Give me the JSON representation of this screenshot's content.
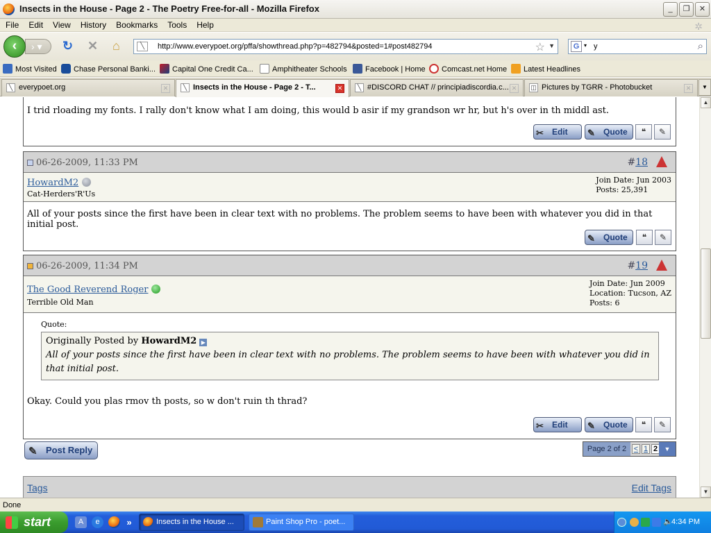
{
  "window": {
    "title": "Insects in the House - Page 2 - The Poetry Free-for-all - Mozilla Firefox",
    "minimize": "_",
    "maximize": "❐",
    "close": "✕"
  },
  "menu": [
    "File",
    "Edit",
    "View",
    "History",
    "Bookmarks",
    "Tools",
    "Help"
  ],
  "nav": {
    "url": "http://www.everypoet.org/pffa/showthread.php?p=482794&posted=1#post482794",
    "search_value": "y",
    "search_engine": "G"
  },
  "bookmarks": [
    "Most Visited",
    "Chase Personal Banki...",
    "Capital One Credit Ca...",
    "Amphitheater Schools",
    "Facebook | Home",
    "Comcast.net Home",
    "Latest Headlines"
  ],
  "tabs": [
    {
      "label": "everypoet.org",
      "active": false
    },
    {
      "label": "Insects in the House - Page 2 - T...",
      "active": true
    },
    {
      "label": "#DISCORD CHAT // principiadiscordia.c...",
      "active": false
    },
    {
      "label": "Pictures by TGRR - Photobucket",
      "active": false
    }
  ],
  "post17": {
    "body": "I trid rloading my fonts. I rally don't know what I am doing, this would b asir if my grandson wr hr, but h's over in th middl ast.",
    "edit_label": "Edit",
    "quote_label": "Quote"
  },
  "post18": {
    "date": "06-26-2009, 11:33 PM",
    "number_prefix": "#",
    "number": "18",
    "username": "HowardM2",
    "user_title": "Cat-Herders'R'Us",
    "join_date": "Join Date: Jun 2003",
    "posts": "Posts: 25,391",
    "body": "All of your posts since the first have been in clear text with no problems. The problem seems to have been with whatever you did in that initial post.",
    "quote_label": "Quote"
  },
  "post19": {
    "date": "06-26-2009, 11:34 PM",
    "number_prefix": "#",
    "number": "19",
    "username": "The Good Reverend Roger",
    "user_title": "Terrible Old Man",
    "join_date": "Join Date: Jun 2009",
    "location": "Location: Tucson, AZ",
    "posts": "Posts: 6",
    "quote_heading": "Quote:",
    "quote_by_prefix": "Originally Posted by",
    "quote_author": "HowardM2",
    "quote_text": "All of your posts since the first have been in clear text with no problems. The problem seems to have been with whatever you did in that initial post.",
    "body": "Okay. Could you plas rmov th posts, so w don't ruin th thrad?",
    "edit_label": "Edit",
    "quote_label": "Quote"
  },
  "footer": {
    "post_reply": "Post Reply",
    "page_label": "Page 2 of 2",
    "prev": "<",
    "page1": "1",
    "page2": "2",
    "tags": "Tags",
    "edit_tags": "Edit Tags"
  },
  "status": "Done",
  "taskbar": {
    "start": "start",
    "tasks": [
      "Insects in the House ...",
      "Paint Shop Pro - poet..."
    ],
    "clock": "4:34 PM",
    "more": "»"
  },
  "colors": {
    "post_header": "#d3d3d3",
    "post_info": "#f5f5ed",
    "link": "#2a5a9a",
    "online": "#2db82d",
    "offline": "#8a8f9a"
  }
}
